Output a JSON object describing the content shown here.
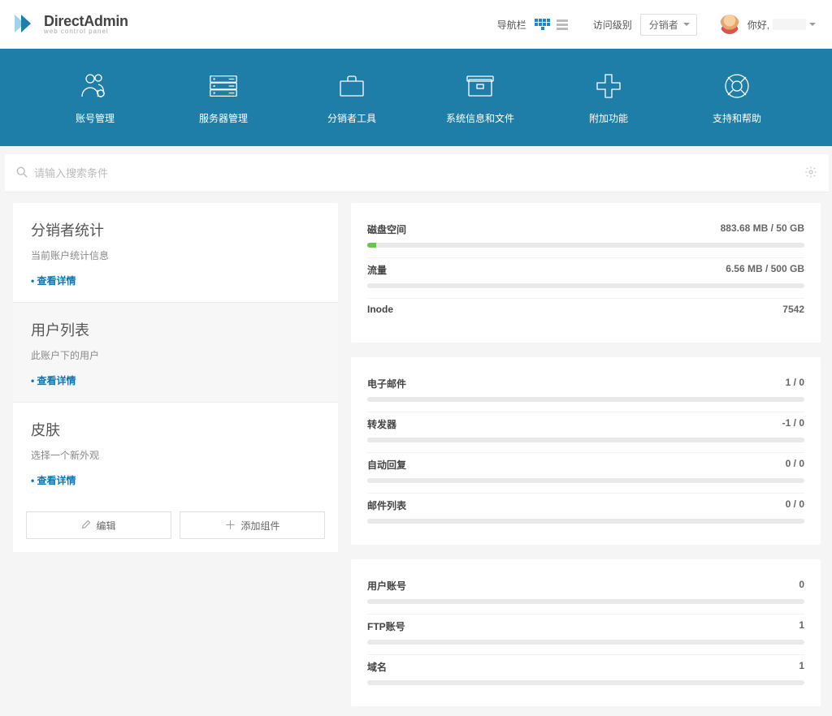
{
  "header": {
    "brand_main": "DirectAdmin",
    "brand_sub": "web control panel",
    "nav_label": "导航栏",
    "access_label": "访问级别",
    "role": "分销者",
    "greeting": "你好,",
    "username_masked": "▇▇▇▇"
  },
  "nav": [
    {
      "id": "accounts",
      "label": "账号管理"
    },
    {
      "id": "server",
      "label": "服务器管理"
    },
    {
      "id": "reseller",
      "label": "分销者工具"
    },
    {
      "id": "system",
      "label": "系统信息和文件"
    },
    {
      "id": "extra",
      "label": "附加功能"
    },
    {
      "id": "support",
      "label": "支持和帮助"
    }
  ],
  "search_placeholder": "请输入搜索条件",
  "sidebar_cards": [
    {
      "title": "分销者统计",
      "desc": "当前账户统计信息",
      "link": "• 查看详情"
    },
    {
      "title": "用户列表",
      "desc": "此账户下的用户",
      "link": "• 查看详情"
    },
    {
      "title": "皮肤",
      "desc": "选择一个新外观",
      "link": "• 查看详情"
    }
  ],
  "sidebar_actions": {
    "edit": "编辑",
    "add": "添加组件"
  },
  "panels": [
    {
      "rows": [
        {
          "label": "磁盘空间",
          "value": "883.68 MB / 50 GB",
          "pct": 2
        },
        {
          "label": "流量",
          "value": "6.56 MB / 500 GB",
          "pct": 0
        },
        {
          "label": "Inode",
          "value": "7542",
          "pct": null
        }
      ]
    },
    {
      "rows": [
        {
          "label": "电子邮件",
          "value": "1 / 0",
          "pct": 0
        },
        {
          "label": "转发器",
          "value": "-1 / 0",
          "pct": 0
        },
        {
          "label": "自动回复",
          "value": "0 / 0",
          "pct": 0
        },
        {
          "label": "邮件列表",
          "value": "0 / 0",
          "pct": 0
        }
      ]
    },
    {
      "rows": [
        {
          "label": "用户账号",
          "value": "0",
          "pct": 0
        },
        {
          "label": "FTP账号",
          "value": "1",
          "pct": 0
        },
        {
          "label": "域名",
          "value": "1",
          "pct": 0
        }
      ]
    }
  ]
}
